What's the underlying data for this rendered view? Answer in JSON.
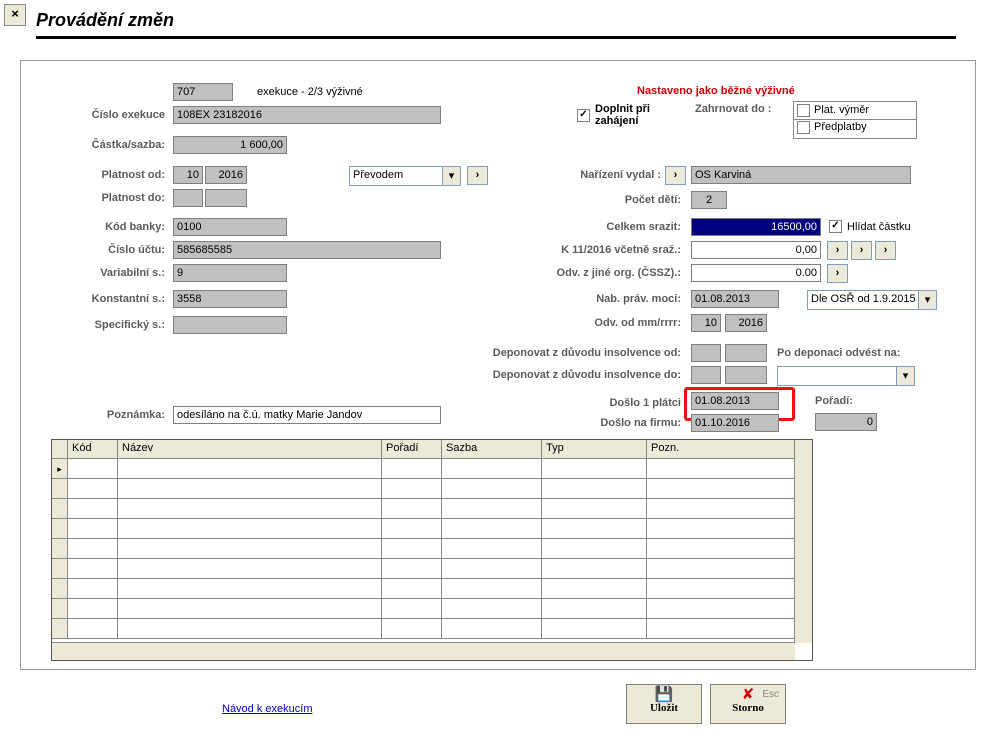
{
  "title": "Provádění změn",
  "close": "×",
  "top": {
    "code": "707",
    "desc": "exekuce - 2/3 výživné"
  },
  "right_head": "Nastaveno jako běžné výživné",
  "doplnit": {
    "label": "Doplnit při zahájení",
    "checked": "✓"
  },
  "zahrnovat_lbl": "Zahrnovat do :",
  "plat_vymer": "Plat. výměr",
  "predplatby": "Předplatby",
  "f": {
    "cislo_exekuce_l": "Číslo exekuce",
    "cislo_exekuce": "108EX 23182016",
    "castka_l": "Částka/sazba:",
    "castka": "1 600,00",
    "plat_od_l": "Platnost od:",
    "pod_m": "10",
    "pod_y": "2016",
    "plat_do_l": "Platnost do:",
    "prevodem": "Převodem",
    "kod_banky_l": "Kód banky:",
    "kod_banky": "0100",
    "cislo_uctu_l": "Číslo účtu:",
    "cislo_uctu": "585685585",
    "vars_l": "Variabilní s.:",
    "vars": "9",
    "ks_l": "Konstantní s.:",
    "ks": "3558",
    "ss_l": "Specifický s.:",
    "poznamka_l": "Poznámka:",
    "poznamka": "odesíláno na č.ú. matky Marie Jandov"
  },
  "r": {
    "narizeni_l": "Nařízení vydal :",
    "narizeni": "OS Karviná",
    "deti_l": "Počet dětí:",
    "deti": "2",
    "celkem_l": "Celkem srazit:",
    "celkem": "16500,00",
    "hlidat": "Hlídat částku",
    "hlidat_c": "✓",
    "k_l": "K 11/2016 včetně sraž.:",
    "k": "0,00",
    "odv_l": "Odv. z jiné org. (ČSSZ).:",
    "odv": "0.00",
    "nab_l": "Nab. práv. moci:",
    "nab": "01.08.2013",
    "osr": "Dle OSŘ od 1.9.2015",
    "odvod_l": "Odv. od mm/rrrr:",
    "odvod_m": "10",
    "odvod_y": "2016",
    "dep_od": "Deponovat z důvodu insolvence od:",
    "po_dep": "Po deponaci odvést na:",
    "dep_do": "Deponovat z důvodu insolvence do:",
    "doslo1_l": "Došlo 1 plátci",
    "doslo1": "01.08.2013",
    "poradi_l": "Pořadí:",
    "poradi": "0",
    "doslof_l": "Došlo na firmu:",
    "doslof": "01.10.2016"
  },
  "arrow": "›",
  "drop": "▾",
  "tbl": {
    "h1": "Kód",
    "h2": "Název",
    "h3": "Pořadí",
    "h4": "Sazba",
    "h5": "Typ",
    "h6": "Pozn."
  },
  "link": "Návod k exekucím",
  "save": "Uložit",
  "cancel": "Storno",
  "esc": "Esc"
}
